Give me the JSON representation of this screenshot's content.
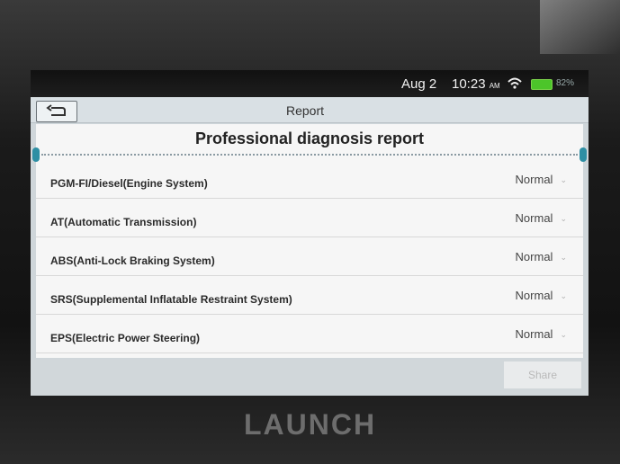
{
  "status_bar": {
    "date": "Aug 2",
    "time": "10:23",
    "ampm": "AM",
    "battery": "82%"
  },
  "header": {
    "title": "Report",
    "back_icon": "back-icon"
  },
  "report": {
    "heading": "Professional diagnosis report",
    "systems": [
      {
        "name": "PGM-FI/Diesel(Engine System)",
        "status": "Normal"
      },
      {
        "name": "AT(Automatic Transmission)",
        "status": "Normal"
      },
      {
        "name": "ABS(Anti-Lock Braking System)",
        "status": "Normal"
      },
      {
        "name": "SRS(Supplemental Inflatable Restraint System)",
        "status": "Normal"
      },
      {
        "name": "EPS(Electric Power Steering)",
        "status": "Normal"
      }
    ]
  },
  "footer": {
    "share_label": "Share"
  },
  "device": {
    "brand": "LAUNCH"
  },
  "colors": {
    "accent": "#2e8fa4",
    "battery": "#4cc52a"
  }
}
